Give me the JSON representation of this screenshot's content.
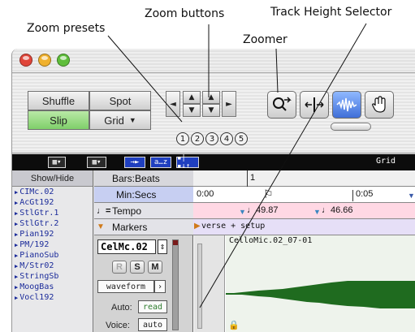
{
  "callouts": {
    "zoom_buttons": "Zoom buttons",
    "track_height_selector": "Track Height Selector",
    "zoom_presets": "Zoom presets",
    "zoomer": "Zoomer"
  },
  "colors": {
    "edit_mode_active": "#7fcf6a",
    "close_light": "#e0463a",
    "minimize_light": "#f0b12e",
    "zoom_light": "#5fbe3b",
    "waveform": "#1f6b1f",
    "tempo_row": "#ffd8e4",
    "markers_row": "#e6dff7",
    "min_secs_row": "#c7cff2"
  },
  "edit_modes": {
    "shuffle": "Shuffle",
    "spot": "Spot",
    "slip": "Slip",
    "grid": "Grid",
    "active": "slip"
  },
  "zoom_presets": [
    "1",
    "2",
    "3",
    "4",
    "5"
  ],
  "toolbar_icons": [
    "zoomer-icon",
    "trim-tool-icon",
    "selector-tool-icon",
    "grabber-hand-icon"
  ],
  "darkstrip": {
    "btn1": "→►",
    "btn2": "a…z",
    "btn3": "▪|▪↓↑",
    "grid_label": "Grid"
  },
  "left_panel": {
    "header": "Show/Hide",
    "tracks": [
      "CIMc.02",
      "AcGt192",
      "StlGtr.1",
      "StlGtr.2",
      "Pian192",
      "PM/192",
      "PianoSub",
      "M/Str02",
      "StringSb",
      "MoogBas",
      "Vocl192"
    ]
  },
  "rulers": {
    "bars_beats": "Bars:Beats",
    "min_secs": "Min:Secs",
    "tempo": "Tempo",
    "markers": "Markers"
  },
  "timeline": {
    "bar_one": "1",
    "time_start": "0:00",
    "time_five": "0:05",
    "tempo_1": "49.87",
    "tempo_2": "46.66",
    "marker_label": "verse + setup"
  },
  "track": {
    "name": "CelMc.02",
    "record": "R",
    "solo": "S",
    "mute": "M",
    "view": "waveform",
    "auto_label": "Auto:",
    "auto_value": "read",
    "voice_label": "Voice:",
    "voice_value": "auto",
    "clip_name": "CelloMic.02_07-01"
  }
}
